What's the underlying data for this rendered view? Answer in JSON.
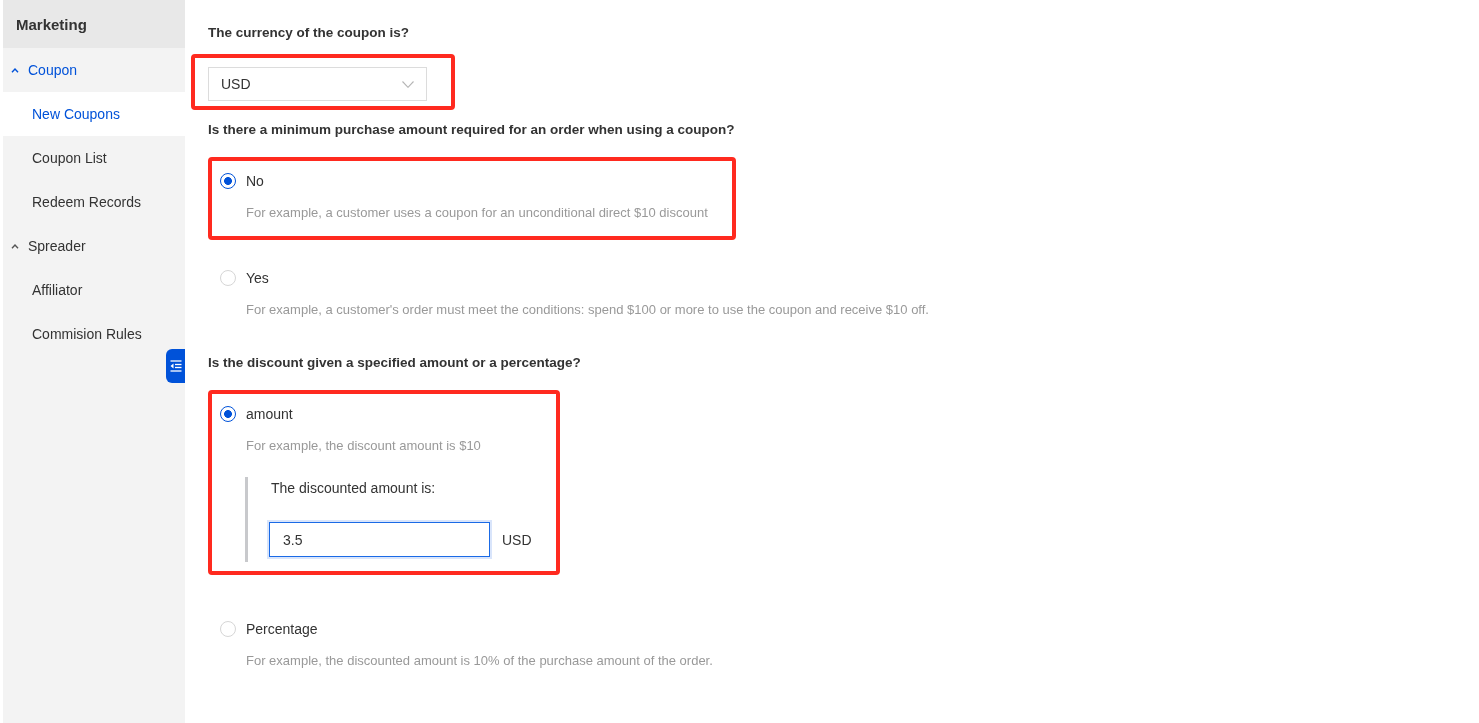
{
  "sidebar": {
    "title": "Marketing",
    "groups": [
      {
        "label": "Coupon",
        "expanded": true,
        "selected": true,
        "children": [
          {
            "label": "New Coupons",
            "selected": true
          },
          {
            "label": "Coupon List",
            "selected": false
          },
          {
            "label": "Redeem Records",
            "selected": false
          }
        ]
      },
      {
        "label": "Spreader",
        "expanded": true,
        "selected": false,
        "children": [
          {
            "label": "Affiliator",
            "selected": false
          },
          {
            "label": "Commision Rules",
            "selected": false
          }
        ]
      }
    ]
  },
  "form": {
    "sections": [
      {
        "kind": "select",
        "question": "The currency of the coupon is?",
        "value": "USD",
        "highlighted": true
      },
      {
        "kind": "radio",
        "question": "Is there a minimum purchase amount required for an order when using a coupon?",
        "options": [
          {
            "label": "No",
            "hint": "For example, a customer uses a coupon for an unconditional direct $10 discount",
            "selected": true,
            "highlighted": true
          },
          {
            "label": "Yes",
            "hint": "For example, a customer's order must meet the conditions: spend $100 or more to use the coupon and receive $10 off.",
            "selected": false,
            "highlighted": false
          }
        ]
      },
      {
        "kind": "radio",
        "question": "Is the discount given a specified amount or a percentage?",
        "options": [
          {
            "label": "amount",
            "hint": "For example, the discount amount is $10",
            "selected": true,
            "highlighted": true,
            "amount_field": {
              "label": "The discounted amount is:",
              "value": "3.5",
              "unit": "USD"
            }
          },
          {
            "label": "Percentage",
            "hint": "For example, the discounted amount is 10% of the purchase amount of the order.",
            "selected": false,
            "highlighted": false
          }
        ]
      }
    ]
  }
}
